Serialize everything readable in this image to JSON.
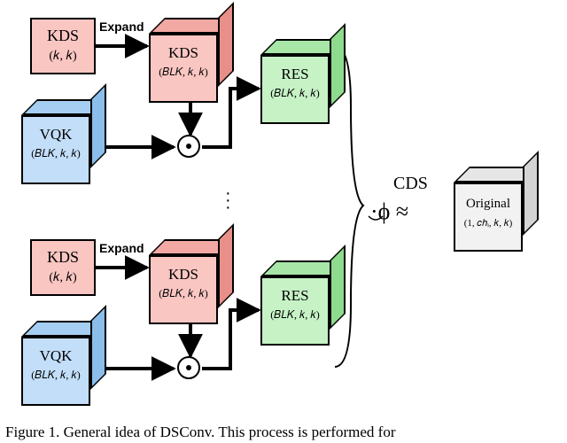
{
  "caption": "Figure 1. General idea of DSConv. This process is performed for",
  "colors": {
    "kds_front": "#fac6c2",
    "kds_shade1": "#f2a9a4",
    "kds_shade2": "#e98f89",
    "vqk_front": "#c2def8",
    "vqk_shade1": "#a5cef2",
    "vqk_shade2": "#8bbeea",
    "res_front": "#c6f2c6",
    "res_shade1": "#a8e6a8",
    "res_shade2": "#8edb8e"
  },
  "labels": {
    "kds": "KDS",
    "kds_dim_small": "(𝑘, 𝑘)",
    "kds_dim_big": "(𝐵𝐿𝐾, 𝑘, 𝑘)",
    "vqk": "VQK",
    "vqk_dim": "(𝐵𝐿𝐾, 𝑘, 𝑘)",
    "res": "RES",
    "res_dim": "(𝐵𝐿𝐾, 𝑘, 𝑘)",
    "expand": "Expand",
    "cds": "CDS",
    "dotphi": "·ϕ ≈",
    "original": "Original",
    "original_dim": "(1, 𝑐ℎᵢ, 𝑘, 𝑘)"
  }
}
